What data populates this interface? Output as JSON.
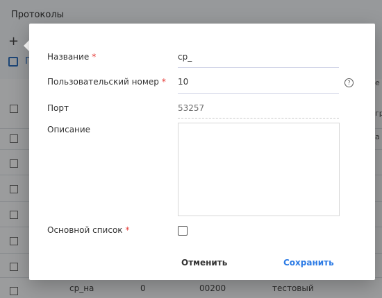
{
  "background": {
    "title": "Протоколы",
    "toolbar": {
      "add_symbol": "+",
      "copy_initial": "П"
    },
    "right_clips": [
      "е",
      "гр",
      "а"
    ],
    "bottom_row_values": [
      "ср_на",
      "0",
      "00200",
      "тестовый"
    ]
  },
  "modal": {
    "fields": {
      "name": {
        "label": "Название",
        "required": true,
        "value": "cp_"
      },
      "user_number": {
        "label": "Пользовательский номер",
        "required": true,
        "value": "10"
      },
      "port": {
        "label": "Порт",
        "value": "53257"
      },
      "description": {
        "label": "Описание",
        "value": ""
      },
      "main_list": {
        "label": "Основной список",
        "required": true,
        "checked": false
      }
    },
    "buttons": {
      "cancel": "Отменить",
      "save": "Сохранить"
    },
    "required_mark": "*",
    "help_icon_symbol": "?"
  }
}
